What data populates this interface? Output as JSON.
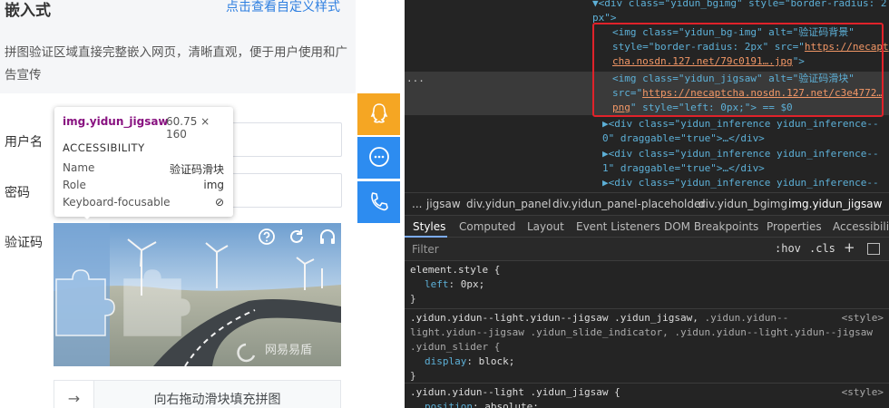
{
  "left": {
    "mode_title": "嵌入式",
    "custom_link": "点击查看自定义样式",
    "description": "拼图验证区域直接完整嵌入网页，清晰直观，便于用户使用和广告宣传",
    "username_label": "用户名",
    "password_label": "密码",
    "captcha_label": "验证码",
    "watermark": "网易易盾",
    "slider_text": "向右拖动滑块填充拼图",
    "slider_arrow": "→",
    "side_buttons": [
      "qq-icon",
      "chat-icon",
      "phone-icon"
    ],
    "accent": "#f5a623",
    "blue": "#2d8cf0"
  },
  "tooltip": {
    "selector": "img.yidun_jigsaw",
    "dimensions": "60.75 × 160",
    "heading": "ACCESSIBILITY",
    "rows": [
      {
        "k": "Name",
        "v": "验证码滑块"
      },
      {
        "k": "Role",
        "v": "img"
      },
      {
        "k": "Keyboard-focusable",
        "v": "⊘"
      }
    ]
  },
  "devtools": {
    "dom_ellipsis": "...",
    "dom": {
      "l0a": "▼<div class=\"yidun_bgimg\" style=\"border-radius: 2",
      "l0b": "px\">",
      "l1a": "<img class=\"yidun_bg-img\" alt=\"验证码背景\"",
      "l1b": "style=\"border-radius: 2px\" src=\"",
      "l1c": "https://necapt",
      "l1d": "cha.nosdn.127.net/79c0191….jpg",
      "l1e": "\">",
      "l2a": "<img class=\"yidun_jigsaw\" alt=\"验证码滑块\"",
      "l2b": "src=\"",
      "l2c": "https://necaptcha.nosdn.127.net/c3e4772…",
      "l2d": "png",
      "l2e": "\" style=\"left: 0px;\"> == $0",
      "l3a": "▶<div class=\"yidun_inference yidun_inference--",
      "l3b": "0\" draggable=\"true\">…</div>",
      "l4a": "▶<div class=\"yidun_inference yidun_inference--",
      "l4b": "1\" draggable=\"true\">…</div>",
      "l5a": "▶<div class=\"yidun_inference yidun_inference--"
    },
    "breadcrumb": [
      "...",
      "jigsaw",
      "div.yidun_panel",
      "div.yidun_panel-placeholder",
      "div.yidun_bgimg",
      "img.yidun_jigsaw"
    ],
    "tabs": [
      "Styles",
      "Computed",
      "Layout",
      "Event Listeners",
      "DOM Breakpoints",
      "Properties",
      "Accessibility"
    ],
    "filter_placeholder": "Filter",
    "hov": ":hov",
    "cls": ".cls",
    "plus": "+",
    "rules": {
      "r1_selector": "element.style {",
      "r1_prop": "left",
      "r1_val": "0px;",
      "close": "}",
      "r2_sel_a": ".yidun.yidun--light.yidun--jigsaw .yidun_jigsaw,",
      "r2_sel_b": " .yidun.yidun--",
      "r2_sel_c": "light.yidun--jigsaw .yidun_slide_indicator, .yidun.yidun--light.yidun--jigsaw",
      "r2_sel_d": ".yidun_slider {",
      "r2_prop": "display",
      "r2_val": "block;",
      "r2_src": "<style>",
      "r3_sel": ".yidun.yidun--light .yidun_jigsaw {",
      "r3_prop": "position",
      "r3_val": "absolute;",
      "r3_src": "<style>"
    }
  }
}
